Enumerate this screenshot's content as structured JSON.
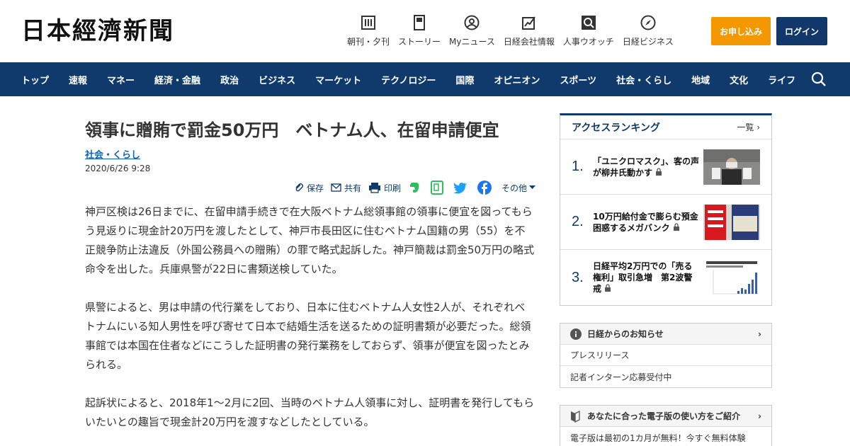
{
  "header": {
    "logo": "日本經濟新聞",
    "services": [
      {
        "label": "朝刊・夕刊",
        "icon": "newspaper-icon"
      },
      {
        "label": "ストーリー",
        "icon": "document-icon"
      },
      {
        "label": "Myニュース",
        "icon": "user-icon"
      },
      {
        "label": "日経会社情報",
        "icon": "chart-icon"
      },
      {
        "label": "人事ウオッチ",
        "icon": "magnifier-icon"
      },
      {
        "label": "日経ビジネス",
        "icon": "compass-icon"
      }
    ],
    "apply_label": "お申し込み",
    "login_label": "ログイン"
  },
  "nav": {
    "items": [
      "トップ",
      "速報",
      "マネー",
      "経済・金融",
      "政治",
      "ビジネス",
      "マーケット",
      "テクノロジー",
      "国際",
      "オピニオン",
      "スポーツ",
      "社会・くらし",
      "地域",
      "文化",
      "ライフ"
    ]
  },
  "article": {
    "title": "領事に贈賄で罰金50万円　ベトナム人、在留申請便宜",
    "category": "社会・くらし",
    "date": "2020/6/26 9:28",
    "toolbar": {
      "save": "保存",
      "share": "共有",
      "print": "印刷",
      "more": "その他"
    },
    "paragraphs": [
      "神戸区検は26日までに、在留申請手続きで在大阪ベトナム総領事館の領事に便宜を図ってもらう見返りに現金計20万円を渡したとして、神戸市長田区に住むベトナム国籍の男（55）を不正競争防止法違反（外国公務員への贈賄）の罪で略式起訴した。神戸簡裁は罰金50万円の略式命令を出した。兵庫県警が22日に書類送検していた。",
      "県警によると、男は申請の代行業をしており、日本に住むベトナム人女性2人が、それぞれベトナムにいる知人男性を呼び寄せて日本で結婚生活を送るための証明書類が必要だった。総領事館では本国在住者などにこうした証明書の発行業務をしておらず、領事が便宜を図ったとみられる。",
      "起訴状によると、2018年1～2月に2回、当時のベトナム人領事に対し、証明書を発行してもらいたいとの趣旨で現金計20万円を渡すなどしたとしている。"
    ]
  },
  "ranking": {
    "title": "アクセスランキング",
    "more": "一覧",
    "items": [
      {
        "rank": "1.",
        "text": "「ユニクロマスク」、客の声が柳井氏動かす"
      },
      {
        "rank": "2.",
        "text": "10万円給付金で膨らむ預金　困惑するメガバンク"
      },
      {
        "rank": "3.",
        "text": "日経平均2万円での「売る権利」取引急増　第2波警戒"
      }
    ]
  },
  "notice": {
    "title": "日経からのお知らせ",
    "rows": [
      "プレスリリース",
      "記者インターン応募受付中"
    ]
  },
  "guide": {
    "title": "あなたに合った電子版の使い方をご紹介",
    "rows": [
      "電子版は最初の1カ月が無料！今すぐ無料体験"
    ]
  },
  "colors": {
    "navy": "#0f3a6b",
    "orange": "#f39800",
    "link": "#0f64b4"
  }
}
